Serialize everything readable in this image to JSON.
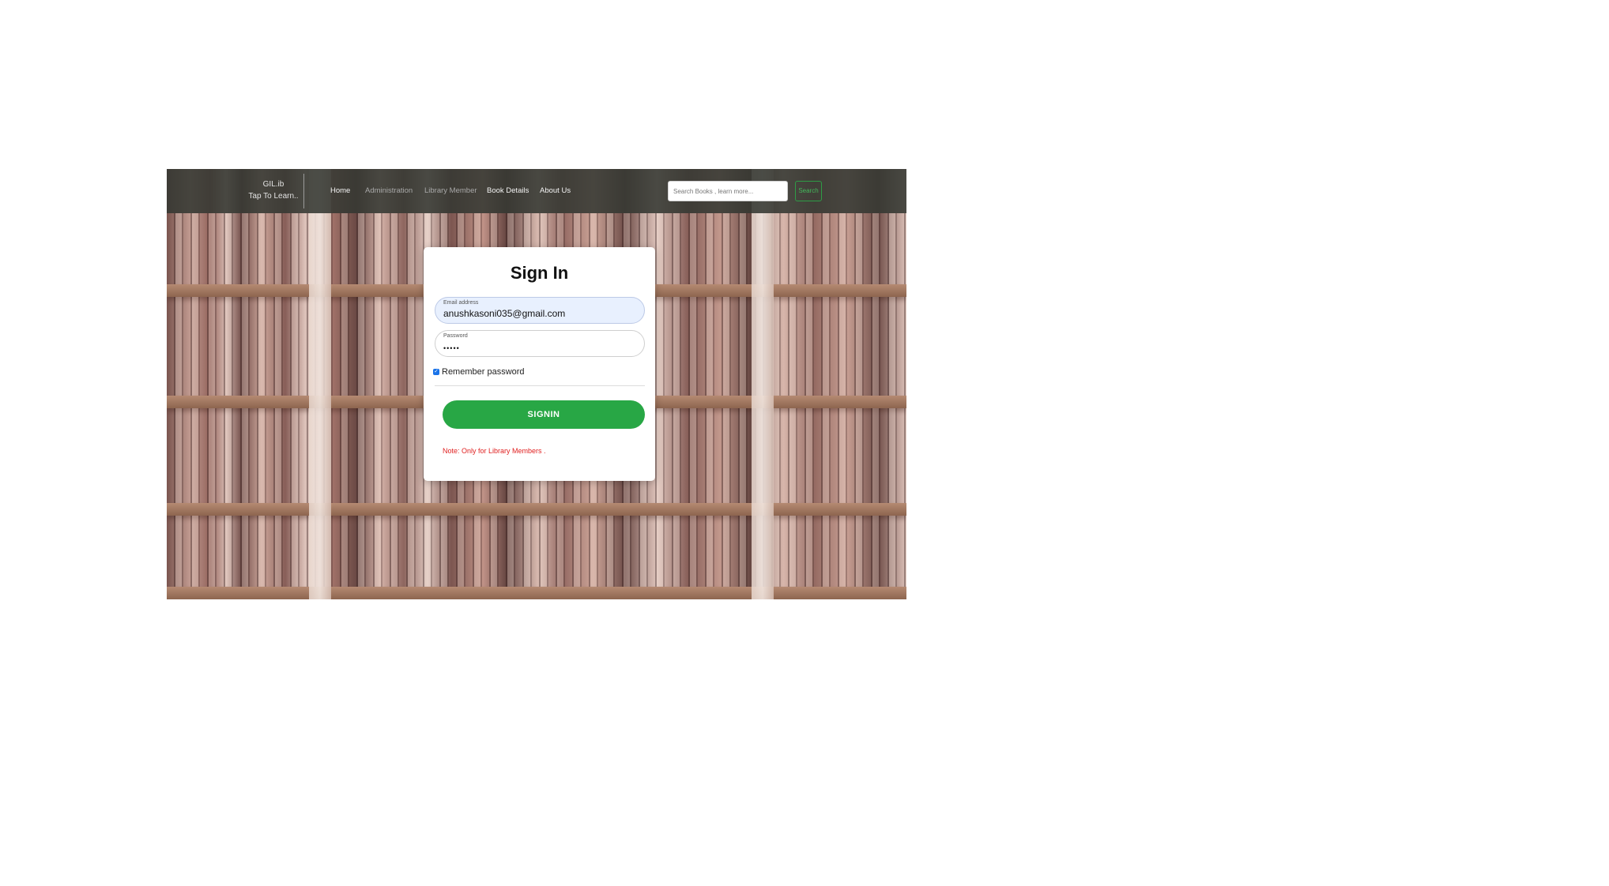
{
  "navbar": {
    "brand_line1": "GIL.ib",
    "brand_line2": "Tap To Learn..",
    "links": [
      "Home",
      "Administration",
      "Library Member",
      "Book Details",
      "About Us"
    ],
    "active_link": "Home",
    "search_placeholder": "Search Books , learn more...",
    "search_button": "Search"
  },
  "signin": {
    "title": "Sign In",
    "email_label": "Email address",
    "email_value": "anushkasoni035@gmail.com",
    "password_label": "Password",
    "password_value": "•••••",
    "remember_label": "Remember password",
    "remember_checked": true,
    "button_label": "SIGNIN",
    "note": "Note: Only for Library Members ."
  },
  "colors": {
    "navbar_bg": "#343832",
    "primary_button": "#28a745",
    "note_text": "#e02020",
    "autofill_bg": "#e8f0fe"
  }
}
